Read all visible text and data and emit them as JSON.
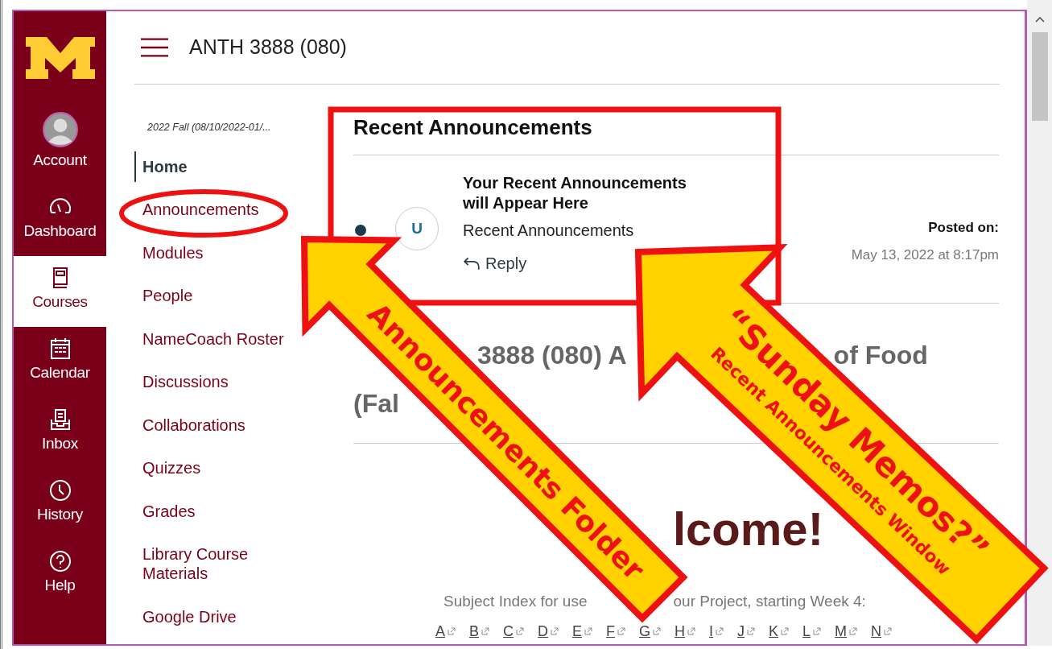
{
  "global_nav": {
    "items": [
      {
        "label": "Account",
        "selected": false
      },
      {
        "label": "Dashboard",
        "selected": false
      },
      {
        "label": "Courses",
        "selected": true
      },
      {
        "label": "Calendar",
        "selected": false
      },
      {
        "label": "Inbox",
        "selected": false
      },
      {
        "label": "History",
        "selected": false
      },
      {
        "label": "Help",
        "selected": false
      }
    ]
  },
  "header": {
    "title": "ANTH 3888 (080)"
  },
  "course_nav": {
    "term": "2022 Fall (08/10/2022-01/...",
    "items": [
      {
        "label": "Home",
        "selected": true
      },
      {
        "label": "Announcements",
        "selected": false
      },
      {
        "label": "Modules",
        "selected": false
      },
      {
        "label": "People",
        "selected": false
      },
      {
        "label": "NameCoach Roster",
        "selected": false
      },
      {
        "label": "Discussions",
        "selected": false
      },
      {
        "label": "Collaborations",
        "selected": false
      },
      {
        "label": "Quizzes",
        "selected": false
      },
      {
        "label": "Grades",
        "selected": false
      },
      {
        "label": "Library Course Materials",
        "selected": false
      },
      {
        "label": "Google Drive",
        "selected": false
      }
    ]
  },
  "recent_announcements": {
    "title": "Recent Announcements",
    "items": [
      {
        "unread": true,
        "avatar": "U",
        "title": "Your Recent Announcements will Appear Here",
        "message": "Recent Announcements",
        "reply": "Reply",
        "posted_label": "Posted on:",
        "posted_date": "May 13, 2022 at 8:17pm"
      }
    ]
  },
  "page": {
    "heading_line_1": [
      "3888 (080) A",
      "of Food"
    ],
    "heading_line_2": [
      "(Fal"
    ],
    "welcome": "lcome!",
    "subject_index": [
      "Subject Index for use",
      "our Project, starting Week 4:"
    ],
    "index_links": [
      "A",
      "B",
      "C",
      "D",
      "E",
      "F",
      "G",
      "H",
      "I",
      "J",
      "K",
      "L",
      "M",
      "N"
    ]
  },
  "annotations": [
    {
      "label": "Announcements Folder"
    },
    {
      "label": "“Sunday Memos?”",
      "sublabel": "Recent Announcements Window"
    }
  ]
}
